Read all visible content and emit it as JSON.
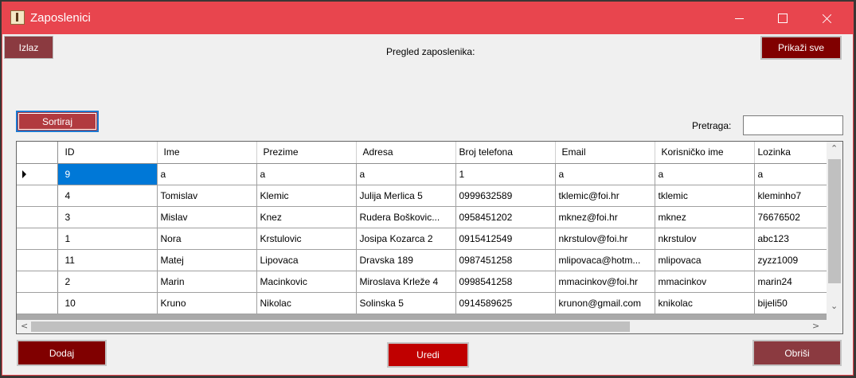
{
  "window": {
    "title": "Zaposlenici",
    "colors": {
      "titlebar": "#e8454e",
      "dark_button": "#800000",
      "accent_button": "#c00000",
      "muted_button": "#8b3a40",
      "selection": "#0078d7"
    }
  },
  "toolbar": {
    "exit_label": "Izlaz",
    "heading": "Pregled zaposlenika:",
    "show_all_label": "Prikaži sve",
    "sort_label": "Sortiraj",
    "search_label": "Pretraga:",
    "search_value": ""
  },
  "grid": {
    "columns": [
      "ID",
      "Ime",
      "Prezime",
      "Adresa",
      "Broj telefona",
      "Email",
      "Korisničko ime",
      "Lozinka"
    ],
    "rows": [
      [
        "9",
        "a",
        "a",
        "a",
        "1",
        "a",
        "a",
        "a"
      ],
      [
        "4",
        "Tomislav",
        "Klemic",
        "Julija Merlica 5",
        "0999632589",
        "tklemic@foi.hr",
        "tklemic",
        "kleminho7"
      ],
      [
        "3",
        "Mislav",
        "Knez",
        "Rudera Boškovic...",
        "0958451202",
        "mknez@foi.hr",
        "mknez",
        "76676502"
      ],
      [
        "1",
        "Nora",
        "Krstulovic",
        "Josipa Kozarca 2",
        "0915412549",
        "nkrstulov@foi.hr",
        "nkrstulov",
        "abc123"
      ],
      [
        "11",
        "Matej",
        "Lipovaca",
        "Dravska 189",
        "0987451258",
        "mlipovaca@hotm...",
        "mlipovaca",
        "zyzz1009"
      ],
      [
        "2",
        "Marin",
        "Macinkovic",
        "Miroslava Krleže 4",
        "0998541258",
        "mmacinkov@foi.hr",
        "mmacinkov",
        "marin24"
      ],
      [
        "10",
        "Kruno",
        "Nikolac",
        "Solinska 5",
        "0914589625",
        "krunon@gmail.com",
        "knikolac",
        "bijeli50"
      ]
    ]
  },
  "actions": {
    "add_label": "Dodaj",
    "edit_label": "Uredi",
    "delete_label": "Obriši"
  }
}
